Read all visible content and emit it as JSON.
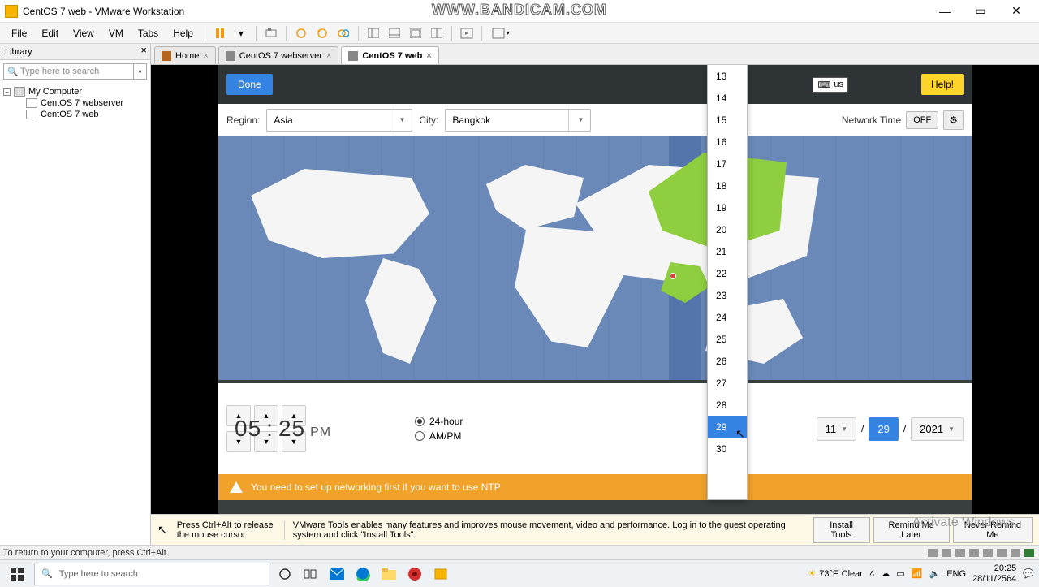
{
  "window": {
    "title": "CentOS 7  web - VMware Workstation",
    "bandicam": "WWW.BANDICAM.COM"
  },
  "menu": {
    "file": "File",
    "edit": "Edit",
    "view": "View",
    "vm": "VM",
    "tabs": "Tabs",
    "help": "Help"
  },
  "library": {
    "title": "Library",
    "search_ph": "Type here to search",
    "root": "My Computer",
    "items": [
      "CentOS 7 webserver",
      "CentOS 7  web"
    ]
  },
  "tabs": [
    {
      "label": "Home",
      "active": false
    },
    {
      "label": "CentOS 7 webserver",
      "active": false
    },
    {
      "label": "CentOS 7  web",
      "active": true
    }
  ],
  "spoke": {
    "done": "Done",
    "kb": "us",
    "help": "Help!",
    "region_lbl": "Region:",
    "region_val": "Asia",
    "city_lbl": "City:",
    "city_val": "Bangkok",
    "nettime_lbl": "Network Time",
    "nettime_state": "OFF",
    "time_h": "05",
    "time_m": "25",
    "time_ampm": "PM",
    "fmt_24": "24-hour",
    "fmt_ampm": "AM/PM",
    "date_month": "11",
    "date_year": "2021",
    "warn": "You need to set up networking first if you want to use NTP"
  },
  "day_list": [
    "13",
    "14",
    "15",
    "16",
    "17",
    "18",
    "19",
    "20",
    "21",
    "22",
    "23",
    "24",
    "25",
    "26",
    "27",
    "28",
    "29",
    "30"
  ],
  "day_selected": "29",
  "toolsbar": {
    "hint1": "Press Ctrl+Alt to release the mouse cursor",
    "msg": "VMware Tools enables many features and improves mouse movement, video and performance. Log in to the guest operating system and click \"Install Tools\".",
    "install": "Install Tools",
    "remind": "Remind Me Later",
    "never": "Never Remind Me",
    "activate": "Activate Windows"
  },
  "statusbar": {
    "text": "To return to your computer, press Ctrl+Alt."
  },
  "taskbar": {
    "search_ph": "Type here to search",
    "weather_temp": "73°F",
    "weather_cond": "Clear",
    "lang": "ENG",
    "time": "20:25",
    "date": "28/11/2564"
  }
}
